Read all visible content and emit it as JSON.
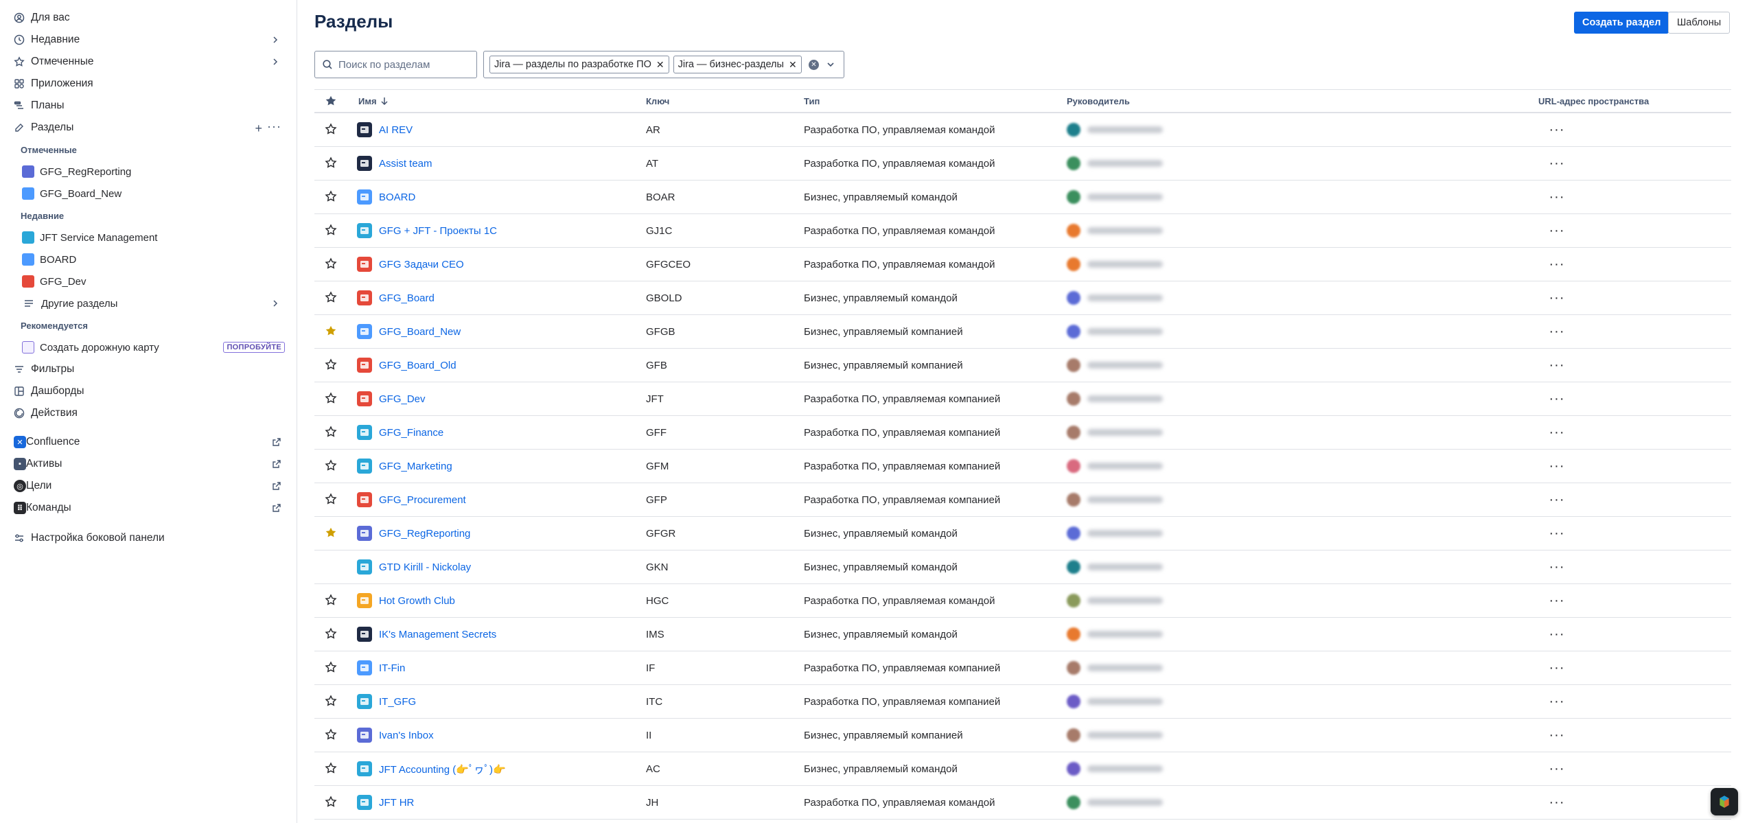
{
  "sidebar": {
    "for_you": "Для вас",
    "recent": "Недавние",
    "starred": "Отмеченные",
    "apps": "Приложения",
    "plans": "Планы",
    "spaces": "Разделы",
    "starred_section": "Отмеченные",
    "starred_items": [
      "GFG_RegReporting",
      "GFG_Board_New"
    ],
    "recent_section": "Недавние",
    "recent_items": [
      "JFT Service Management",
      "BOARD",
      "GFG_Dev"
    ],
    "other_spaces": "Другие разделы",
    "recommended_section": "Рекомендуется",
    "create_roadmap": "Создать дорожную карту",
    "try_badge": "ПОПРОБУЙТЕ",
    "filters": "Фильтры",
    "dashboards": "Дашборды",
    "actions": "Действия",
    "confluence": "Confluence",
    "assets": "Активы",
    "goals": "Цели",
    "teams": "Команды",
    "customize": "Настройка боковой панели"
  },
  "main": {
    "title": "Разделы",
    "create_button": "Создать раздел",
    "templates_button": "Шаблоны",
    "search_placeholder": "Поиск по разделам",
    "filter_chips": [
      "Jira — разделы по разработке ПО",
      "Jira — бизнес-разделы"
    ]
  },
  "table": {
    "headers": {
      "name": "Имя",
      "key": "Ключ",
      "type": "Тип",
      "lead": "Руководитель",
      "url": "URL-адрес пространства"
    },
    "rows": [
      {
        "name": "AI REV",
        "key": "AR",
        "type": "Разработка ПО, управляемая командой",
        "starred": false,
        "icon_color": "#1f2a44",
        "lead_color": "#1d7f8c"
      },
      {
        "name": "Assist team",
        "key": "AT",
        "type": "Разработка ПО, управляемая командой",
        "starred": false,
        "icon_color": "#1f2a44",
        "lead_color": "#3b8f5e"
      },
      {
        "name": "BOARD",
        "key": "BOAR",
        "type": "Бизнес, управляемый командой",
        "starred": false,
        "icon_color": "#4c9aff",
        "lead_color": "#3b8f5e"
      },
      {
        "name": "GFG + JFT - Проекты 1С",
        "key": "GJ1C",
        "type": "Разработка ПО, управляемая командой",
        "starred": false,
        "icon_color": "#2aa7d8",
        "lead_color": "#e8792e"
      },
      {
        "name": "GFG Задачи CEO",
        "key": "GFGCEO",
        "type": "Разработка ПО, управляемая командой",
        "starred": false,
        "icon_color": "#e5493a",
        "lead_color": "#e8792e"
      },
      {
        "name": "GFG_Board",
        "key": "GBOLD",
        "type": "Бизнес, управляемый командой",
        "starred": false,
        "icon_color": "#e5493a",
        "lead_color": "#5b6bd6"
      },
      {
        "name": "GFG_Board_New",
        "key": "GFGB",
        "type": "Бизнес, управляемый компанией",
        "starred": true,
        "icon_color": "#4c9aff",
        "lead_color": "#5b6bd6"
      },
      {
        "name": "GFG_Board_Old",
        "key": "GFB",
        "type": "Бизнес, управляемый компанией",
        "starred": false,
        "icon_color": "#e5493a",
        "lead_color": "#a77b6a"
      },
      {
        "name": "GFG_Dev",
        "key": "JFT",
        "type": "Разработка ПО, управляемая компанией",
        "starred": false,
        "icon_color": "#e5493a",
        "lead_color": "#a77b6a"
      },
      {
        "name": "GFG_Finance",
        "key": "GFF",
        "type": "Разработка ПО, управляемая компанией",
        "starred": false,
        "icon_color": "#2aa7d8",
        "lead_color": "#a77b6a"
      },
      {
        "name": "GFG_Marketing",
        "key": "GFM",
        "type": "Разработка ПО, управляемая компанией",
        "starred": false,
        "icon_color": "#2aa7d8",
        "lead_color": "#d96a7f"
      },
      {
        "name": "GFG_Procurement",
        "key": "GFP",
        "type": "Разработка ПО, управляемая компанией",
        "starred": false,
        "icon_color": "#e5493a",
        "lead_color": "#a77b6a"
      },
      {
        "name": "GFG_RegReporting",
        "key": "GFGR",
        "type": "Бизнес, управляемый командой",
        "starred": true,
        "icon_color": "#5b6bd6",
        "lead_color": "#5b6bd6"
      },
      {
        "name": "GTD Kirill - Nickolay",
        "key": "GKN",
        "type": "Бизнес, управляемый командой",
        "starred": null,
        "icon_color": "#2aa7d8",
        "lead_color": "#1d7f8c"
      },
      {
        "name": "Hot Growth Club",
        "key": "HGC",
        "type": "Разработка ПО, управляемая командой",
        "starred": false,
        "icon_color": "#f5a623",
        "lead_color": "#8a9a5b"
      },
      {
        "name": "IK's Management Secrets",
        "key": "IMS",
        "type": "Бизнес, управляемый командой",
        "starred": false,
        "icon_color": "#1f2a44",
        "lead_color": "#e8792e"
      },
      {
        "name": "IT-Fin",
        "key": "IF",
        "type": "Разработка ПО, управляемая компанией",
        "starred": false,
        "icon_color": "#4c9aff",
        "lead_color": "#a77b6a"
      },
      {
        "name": "IT_GFG",
        "key": "ITC",
        "type": "Разработка ПО, управляемая компанией",
        "starred": false,
        "icon_color": "#2aa7d8",
        "lead_color": "#6b5bc6"
      },
      {
        "name": "Ivan's Inbox",
        "key": "II",
        "type": "Бизнес, управляемый компанией",
        "starred": false,
        "icon_color": "#5b6bd6",
        "lead_color": "#a77b6a"
      },
      {
        "name": "JFT Accounting (👉ﾟヮﾟ)👉",
        "key": "AC",
        "type": "Бизнес, управляемый командой",
        "starred": false,
        "icon_color": "#2aa7d8",
        "lead_color": "#6b5bc6"
      },
      {
        "name": "JFT HR",
        "key": "JH",
        "type": "Разработка ПО, управляемая командой",
        "starred": false,
        "icon_color": "#2aa7d8",
        "lead_color": "#3b8f5e"
      }
    ]
  },
  "colors": {
    "primary": "#0c66e4",
    "star_filled": "#cf9f02",
    "link": "#0c66e4"
  }
}
